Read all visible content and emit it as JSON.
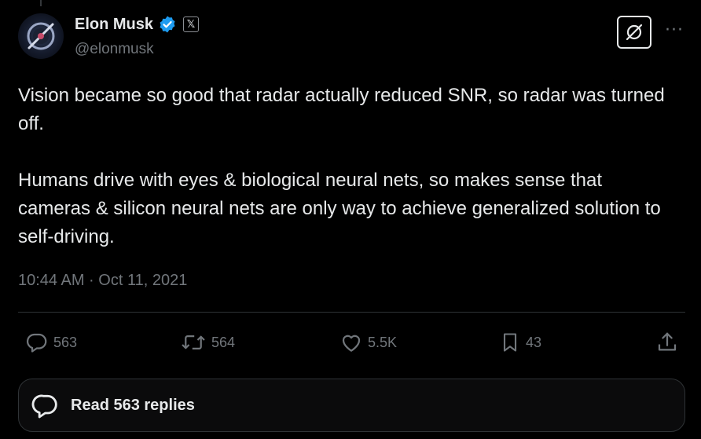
{
  "author": {
    "name": "Elon Musk",
    "handle": "@elonmusk",
    "affiliate_badge": "𝕏",
    "verified_color": "#1d9bf0"
  },
  "tweet": {
    "paragraphs": [
      "Vision became so good that radar actually reduced SNR, so radar was turned off.",
      "Humans drive with eyes & biological neural nets, so makes sense that cameras & silicon neural nets are only way to achieve generalized solution to self-driving."
    ],
    "timestamp": "10:44 AM · Oct 11, 2021"
  },
  "actions": {
    "replies": "563",
    "reposts": "564",
    "likes": "5.5K",
    "bookmarks": "43"
  },
  "read_replies_label": "Read 563 replies",
  "header_buttons": {
    "more_label": "···"
  },
  "icons": [
    "verified-icon",
    "grok-icon",
    "more-icon",
    "reply-icon",
    "repost-icon",
    "like-icon",
    "bookmark-icon",
    "share-icon",
    "chat-bubble-icon"
  ],
  "colors": {
    "background": "#000000",
    "text": "#e7e9ea",
    "secondary_text": "#71767b",
    "divider": "#2f3336"
  }
}
